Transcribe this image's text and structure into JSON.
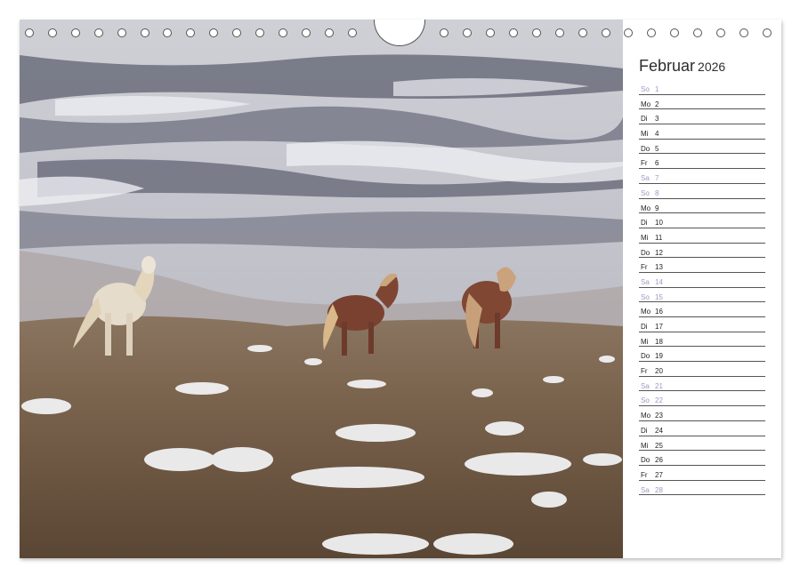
{
  "calendar": {
    "month": "Februar",
    "year": "2026",
    "days": [
      {
        "wd": "So",
        "d": "1",
        "weekend": true
      },
      {
        "wd": "Mo",
        "d": "2",
        "weekend": false
      },
      {
        "wd": "Di",
        "d": "3",
        "weekend": false
      },
      {
        "wd": "Mi",
        "d": "4",
        "weekend": false
      },
      {
        "wd": "Do",
        "d": "5",
        "weekend": false
      },
      {
        "wd": "Fr",
        "d": "6",
        "weekend": false
      },
      {
        "wd": "Sa",
        "d": "7",
        "weekend": true
      },
      {
        "wd": "So",
        "d": "8",
        "weekend": true
      },
      {
        "wd": "Mo",
        "d": "9",
        "weekend": false
      },
      {
        "wd": "Di",
        "d": "10",
        "weekend": false
      },
      {
        "wd": "Mi",
        "d": "11",
        "weekend": false
      },
      {
        "wd": "Do",
        "d": "12",
        "weekend": false
      },
      {
        "wd": "Fr",
        "d": "13",
        "weekend": false
      },
      {
        "wd": "Sa",
        "d": "14",
        "weekend": true
      },
      {
        "wd": "So",
        "d": "15",
        "weekend": true
      },
      {
        "wd": "Mo",
        "d": "16",
        "weekend": false
      },
      {
        "wd": "Di",
        "d": "17",
        "weekend": false
      },
      {
        "wd": "Mi",
        "d": "18",
        "weekend": false
      },
      {
        "wd": "Do",
        "d": "19",
        "weekend": false
      },
      {
        "wd": "Fr",
        "d": "20",
        "weekend": false
      },
      {
        "wd": "Sa",
        "d": "21",
        "weekend": true
      },
      {
        "wd": "So",
        "d": "22",
        "weekend": true
      },
      {
        "wd": "Mo",
        "d": "23",
        "weekend": false
      },
      {
        "wd": "Di",
        "d": "24",
        "weekend": false
      },
      {
        "wd": "Mi",
        "d": "25",
        "weekend": false
      },
      {
        "wd": "Do",
        "d": "26",
        "weekend": false
      },
      {
        "wd": "Fr",
        "d": "27",
        "weekend": false
      },
      {
        "wd": "Sa",
        "d": "28",
        "weekend": true
      }
    ]
  },
  "colors": {
    "weekday_text": "#222222",
    "weekend_text": "#9a9ac2",
    "rule_line": "#555555"
  }
}
